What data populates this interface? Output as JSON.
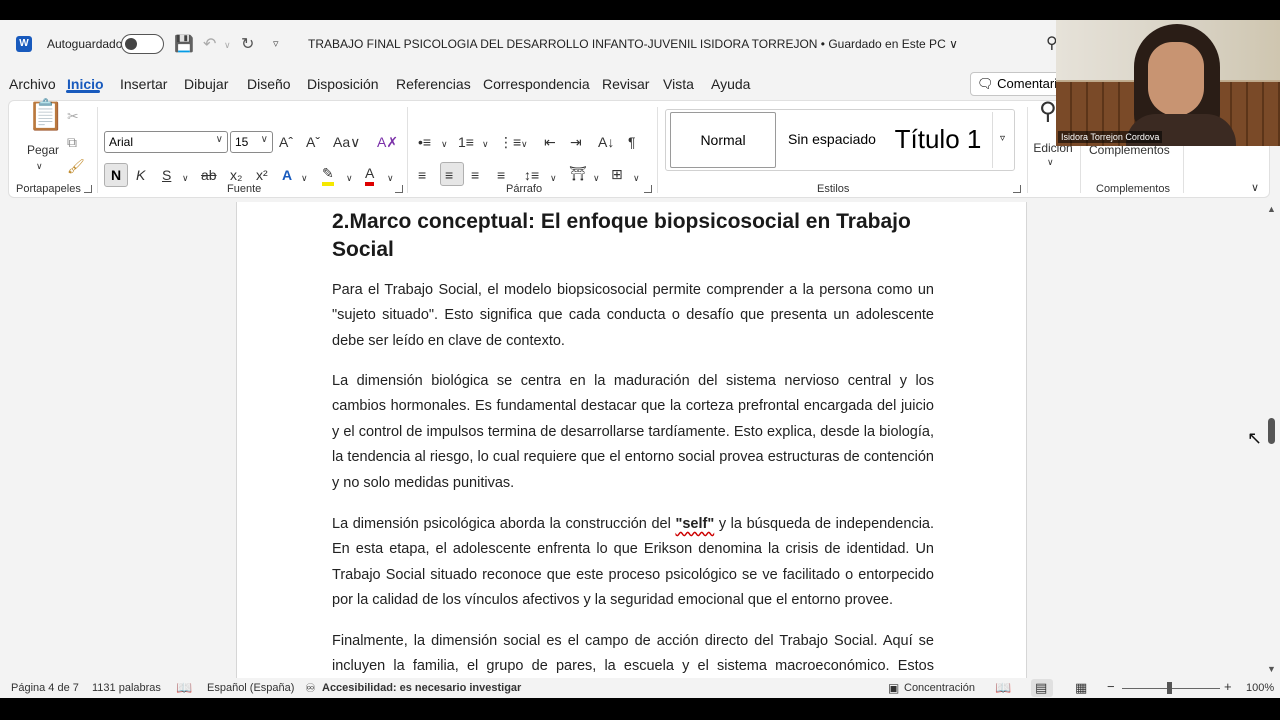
{
  "titlebar": {
    "autosave_label": "Autoguardado",
    "doc_title": "TRABAJO FINAL PSICOLOGIA DEL DESARROLLO INFANTO-JUVENIL ISIDORA TORREJON • Guardado en Este PC ∨"
  },
  "menu": {
    "items": [
      "Archivo",
      "Inicio",
      "Insertar",
      "Dibujar",
      "Diseño",
      "Disposición",
      "Referencias",
      "Correspondencia",
      "Revisar",
      "Vista",
      "Ayuda"
    ],
    "comment_label": "Comentarios"
  },
  "ribbon": {
    "paste_label": "Pegar",
    "font_name": "Arial",
    "font_size": "15",
    "bold": "N",
    "italic": "K",
    "underline": "S",
    "strike": "ab",
    "subscript": "x₂",
    "superscript": "x²",
    "groups": {
      "clipboard": "Portapapeles",
      "font": "Fuente",
      "paragraph": "Párrafo",
      "styles": "Estilos",
      "addins": "Complementos"
    },
    "styles": {
      "normal": "Normal",
      "no_spacing": "Sin espaciado",
      "title1": "Título 1"
    },
    "editing_label": "Edición",
    "addins_label": "Complementos"
  },
  "webcam": {
    "name": "Isidora Torrejon Cordova"
  },
  "document": {
    "heading": "2.Marco conceptual: El enfoque biopsicosocial en Trabajo Social",
    "p1": "Para el Trabajo Social, el modelo biopsicosocial permite comprender a la persona como un \"sujeto situado\". Esto significa que cada conducta o desafío que presenta un adolescente debe ser leído en clave de contexto.",
    "p2": "La dimensión biológica se centra en la maduración del sistema nervioso central y los cambios hormonales. Es fundamental destacar que la corteza prefrontal encargada del juicio y el control de impulsos termina de desarrollarse tardíamente. Esto explica, desde la biología, la tendencia al riesgo, lo cual requiere que el entorno social provea estructuras de contención y no solo medidas punitivas.",
    "p3_before": "La dimensión psicológica aborda la construcción del ",
    "p3_self": "\"self\"",
    "p3_after": " y la búsqueda de independencia. En esta etapa, el adolescente enfrenta lo que Erikson denomina la crisis de identidad. Un Trabajo Social situado reconoce que este proceso psicológico se ve facilitado o entorpecido por la calidad de los vínculos afectivos y la seguridad emocional que el entorno provee.",
    "p4": "Finalmente, la dimensión social es el campo de acción directo del Trabajo Social. Aquí se incluyen la familia, el grupo de pares, la escuela y el sistema macroeconómico. Estos entornos"
  },
  "status": {
    "page": "Página 4 de 7",
    "words": "1131 palabras",
    "language": "Español (España)",
    "accessibility": "Accesibilidad: es necesario investigar",
    "focus": "Concentración",
    "zoom": "100%"
  }
}
